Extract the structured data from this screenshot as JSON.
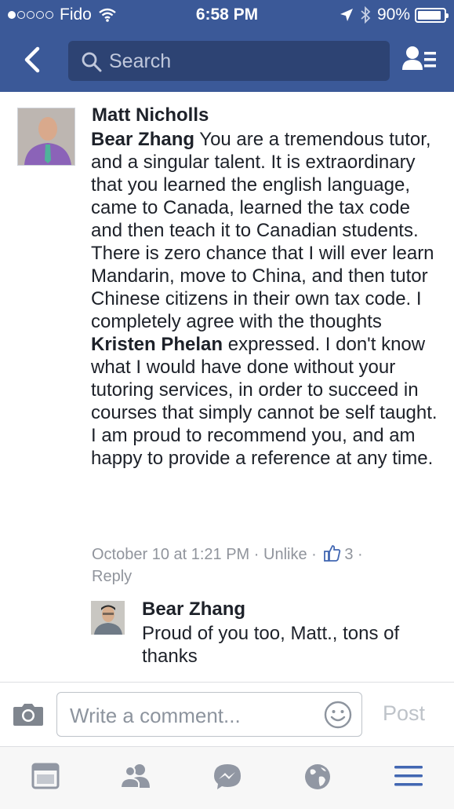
{
  "status_bar": {
    "carrier": "Fido",
    "time": "6:58 PM",
    "battery": "90%",
    "battery_level": 0.9
  },
  "nav": {
    "back_icon": "chevron-left-icon",
    "search_placeholder": "Search",
    "friends_icon": "friends-list-icon"
  },
  "comment": {
    "author": "Matt Nicholls",
    "mention1": "Bear Zhang",
    "text_part1": " You are a tremendous tutor, and a singular talent. It is extraordinary that you learned the english language, came to Canada, learned the tax code and then teach it to Canadian students. There is zero chance that I will ever learn Mandarin, move to China, and then tutor Chinese citizens in their own tax code. I completely agree with the thoughts ",
    "mention2": "Kristen Phelan",
    "text_part2": " expressed. I don't know what I would have done without your tutoring services, in order to succeed in courses that simply cannot be self taught. I am proud to recommend you, and am happy to provide a reference at any time.",
    "timestamp": "October 10 at 1:21 PM",
    "separator": " · ",
    "unlike": "Unlike",
    "like_count": "3",
    "reply": "Reply"
  },
  "reply": {
    "author": "Bear Zhang",
    "text": "Proud of you too, Matt., tons of thanks"
  },
  "composer": {
    "placeholder": "Write a comment...",
    "post_label": "Post"
  },
  "tabs": [
    {
      "icon": "news-feed-icon"
    },
    {
      "icon": "friend-requests-icon"
    },
    {
      "icon": "messenger-icon"
    },
    {
      "icon": "globe-notifications-icon"
    },
    {
      "icon": "menu-icon",
      "active": true
    }
  ],
  "colors": {
    "brand": "#3b5998",
    "brand_dark": "#2d4373",
    "active_tab": "#4267b2",
    "inactive_tab": "#9197a3",
    "meta_text": "#90949c"
  }
}
